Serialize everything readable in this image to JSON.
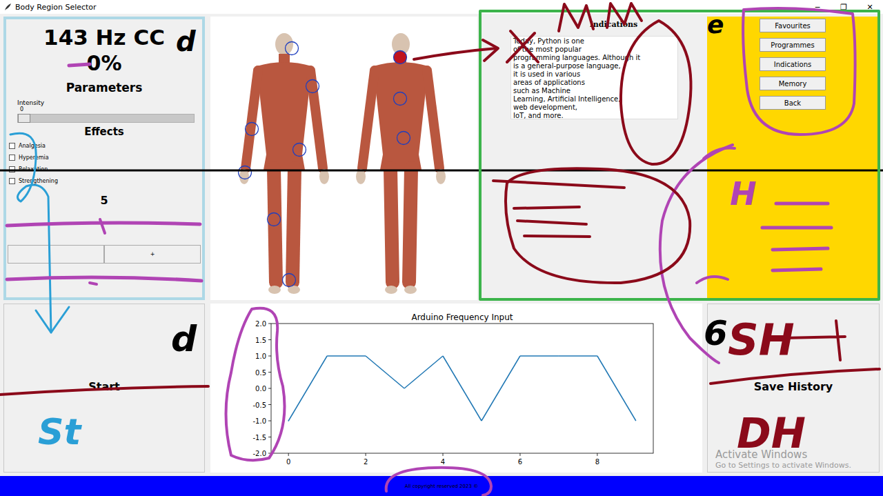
{
  "window": {
    "title": "Body Region Selector",
    "controls": [
      "─",
      "❐",
      "✕"
    ]
  },
  "parameters_panel": {
    "frequency": "143 Hz CC",
    "percent": "0%",
    "heading": "Parameters",
    "intensity": {
      "label": "Intensity",
      "value": "0",
      "level": 0
    },
    "effects_heading": "Effects",
    "effects": [
      {
        "label": "Analgesia",
        "checked": false
      },
      {
        "label": "Hyperemia",
        "checked": false
      },
      {
        "label": "Relaxation",
        "checked": false
      },
      {
        "label": "Strengthening",
        "checked": false
      }
    ],
    "count": "5",
    "buttons": [
      "",
      "+"
    ]
  },
  "body_regions": [
    {
      "selected": false
    },
    {
      "selected": false
    },
    {
      "selected": false
    },
    {
      "selected": false
    },
    {
      "selected": false
    },
    {
      "selected": false
    },
    {
      "selected": false
    },
    {
      "selected": true
    },
    {
      "selected": false
    },
    {
      "selected": false
    }
  ],
  "indications": {
    "title": "Indications",
    "lines": [
      "Today, Python is one",
      "of the most popular",
      "programming languages. Although it",
      "is a general-purpose language,",
      "it is used in various",
      "areas of applications",
      "such as Machine",
      "Learning, Artificial Intelligence,",
      "web development,",
      "IoT, and more."
    ]
  },
  "menu_buttons": [
    "Favourites",
    "Programmes",
    "Indications",
    "Memory",
    "Back"
  ],
  "start_button": "Start",
  "chart": {
    "title": "Arduino Frequency Input",
    "y_ticks": [
      "2.0",
      "1.5",
      "1.0",
      "0.5",
      "0.0",
      "-0.5",
      "-1.0",
      "-1.5",
      "-2.0"
    ],
    "x_ticks": [
      "0",
      "2",
      "4",
      "6",
      "8"
    ],
    "series": [
      {
        "values": [
          -1,
          1,
          1,
          0,
          1,
          -1,
          1,
          1,
          1,
          -1
        ]
      }
    ]
  },
  "save_history_button": "Save History",
  "watermark": {
    "title": "Activate Windows",
    "subtitle": "Go to Settings to activate Windows."
  },
  "footer": "All copyright reserved 2023 ©",
  "annotations": [
    {
      "text": "d",
      "color": "#000000"
    },
    {
      "text": "e",
      "color": "#000000"
    },
    {
      "text": "H",
      "color": "#b044b4"
    },
    {
      "text": "6",
      "color": "#000000"
    },
    {
      "text": "SH",
      "color": "#8b0a1a"
    },
    {
      "text": "d",
      "color": "#000000"
    },
    {
      "text": "St",
      "color": "#2a9fd6"
    },
    {
      "text": "DH",
      "color": "#8b0a1a"
    }
  ]
}
